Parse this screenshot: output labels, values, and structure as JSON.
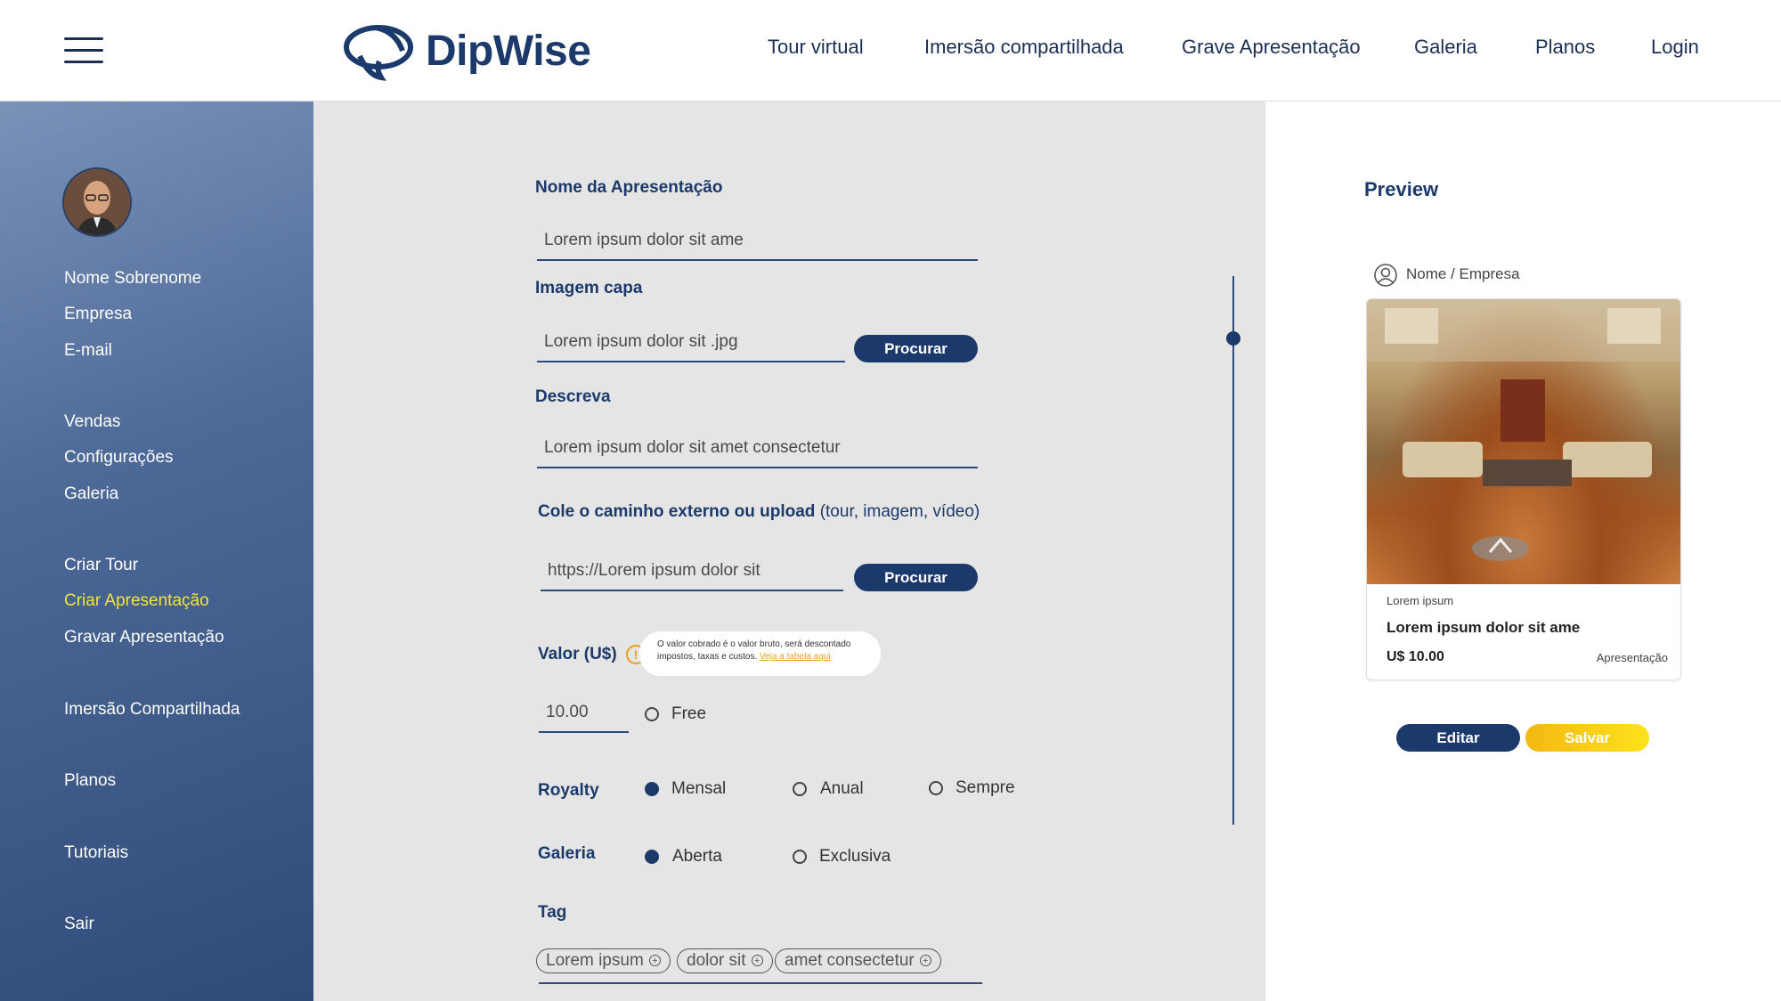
{
  "header": {
    "logo_text": "DipWise",
    "nav": [
      "Tour virtual",
      "Imersão compartilhada",
      "Grave Apresentação",
      "Galeria",
      "Planos",
      "Login"
    ]
  },
  "sidebar": {
    "profile": [
      "Nome Sobrenome",
      "Empresa",
      "E-mail"
    ],
    "items": [
      "Vendas",
      "Configurações",
      "Galeria",
      "Criar Tour",
      "Criar Apresentação",
      "Gravar Apresentação",
      "Imersão Compartilhada",
      "Planos",
      "Tutoriais",
      "Sair"
    ],
    "active_item": "Criar Apresentação"
  },
  "form": {
    "name_label": "Nome da Apresentação",
    "name_value": "Lorem ipsum dolor sit ame",
    "cover_label": "Imagem capa",
    "cover_value": "Lorem ipsum dolor sit .jpg",
    "browse_label": "Procurar",
    "describe_label": "Descreva",
    "describe_value": "Lorem ipsum dolor sit amet consectetur",
    "external_label_bold": "Cole o caminho externo ou upload",
    "external_label_rest": "(tour, imagem, vídeo)",
    "external_value": "https://Lorem ipsum dolor sit",
    "value_label": "Valor (U$)",
    "tooltip_text": "O valor cobrado é o valor bruto, será descontado impostos, taxas e custos.",
    "tooltip_link": "Veja a tabela aqui",
    "value_input": "10.00",
    "free_label": "Free",
    "royalty_label": "Royalty",
    "royalty_options": [
      "Mensal",
      "Anual",
      "Sempre"
    ],
    "royalty_selected": "Mensal",
    "gallery_label": "Galeria",
    "gallery_options": [
      "Aberta",
      "Exclusiva"
    ],
    "gallery_selected": "Aberta",
    "tag_label": "Tag",
    "tags": [
      "Lorem ipsum",
      "dolor sit",
      "amet consectetur"
    ]
  },
  "preview": {
    "title": "Preview",
    "user": "Nome / Empresa",
    "card_small": "Lorem ipsum",
    "card_title": "Lorem ipsum dolor sit ame",
    "card_price": "U$ 10.00",
    "card_type": "Apresentação",
    "edit_label": "Editar",
    "save_label": "Salvar"
  },
  "colors": {
    "primary": "#1b3a6b",
    "accent": "#f3e43a",
    "save": "#fde21b",
    "warning": "#e6a21d"
  }
}
